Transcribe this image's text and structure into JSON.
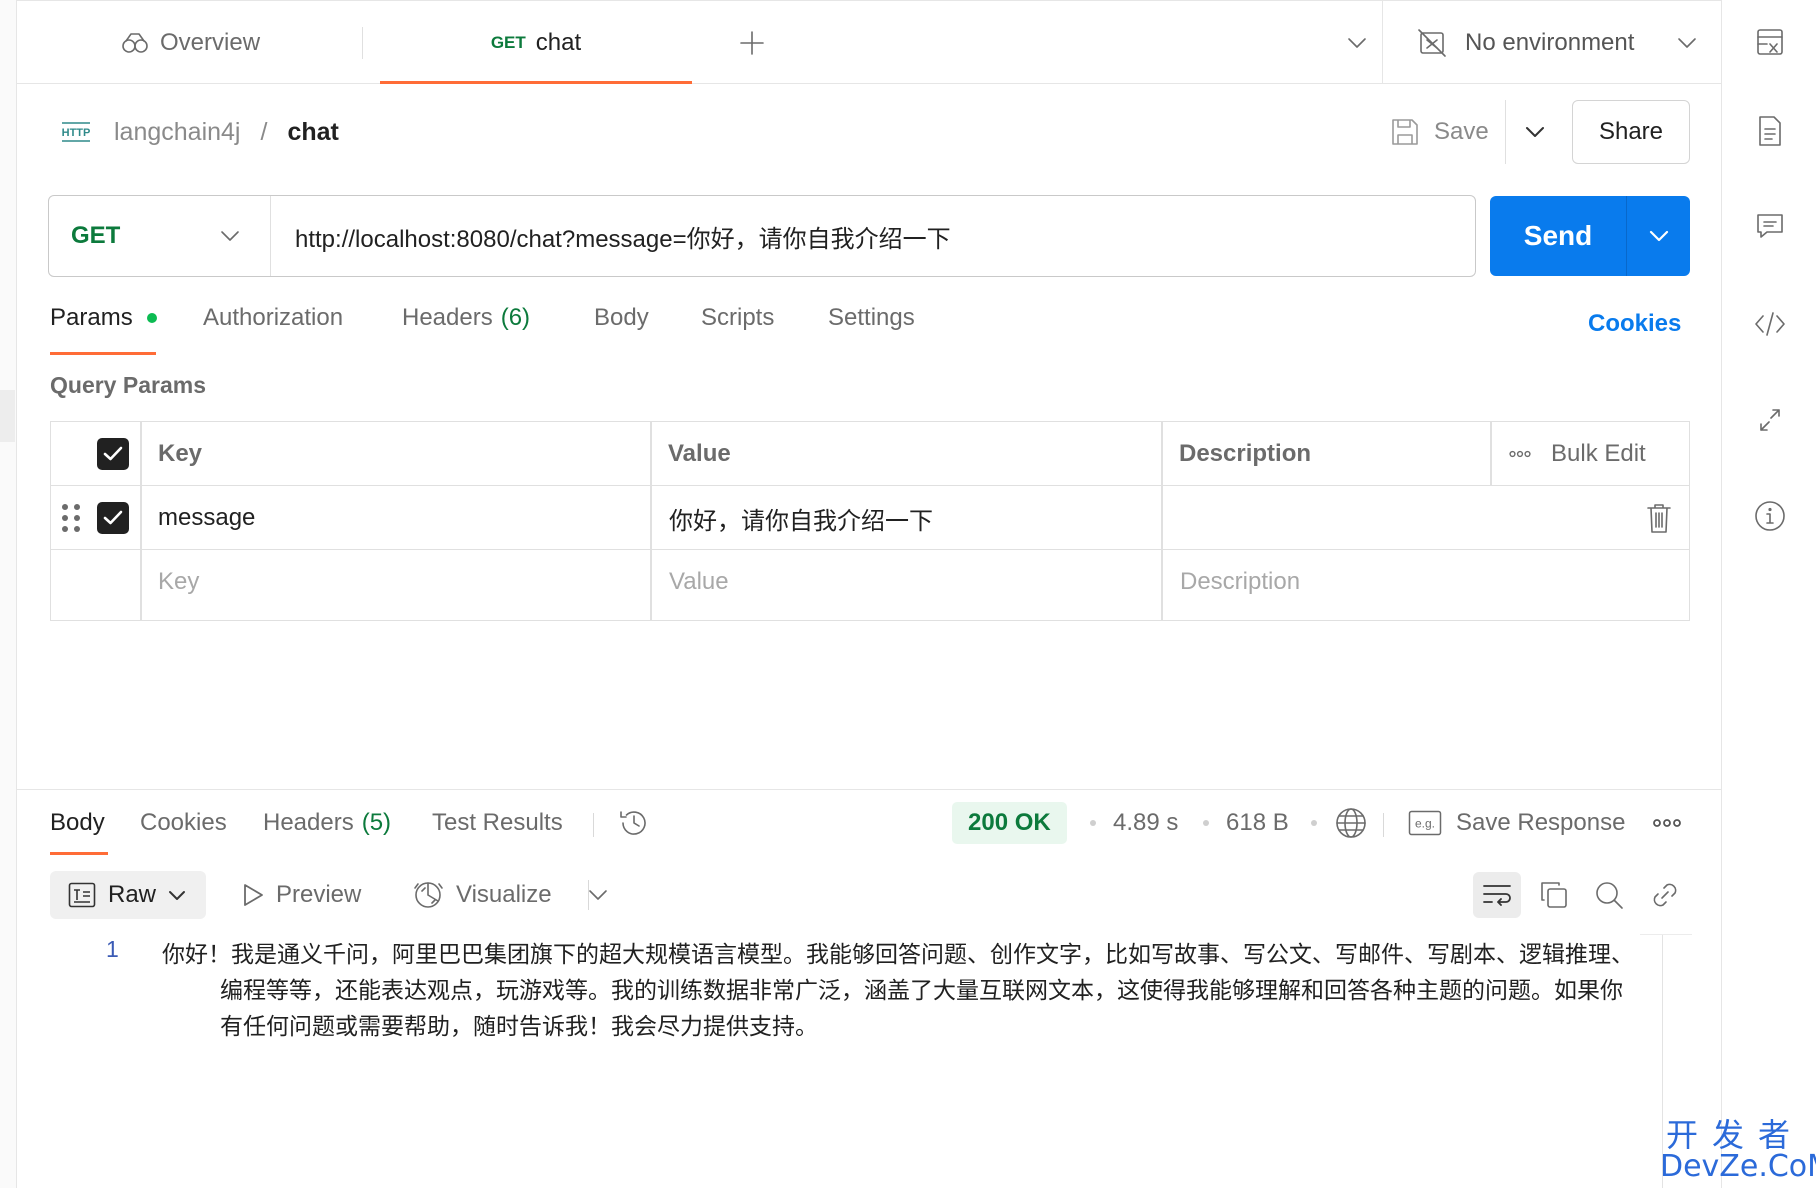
{
  "tabs": {
    "overview_label": "Overview",
    "active_method": "GET",
    "active_label": "chat"
  },
  "environment": {
    "label": "No environment"
  },
  "breadcrumb": {
    "collection": "langchain4j",
    "separator": "/",
    "request": "chat"
  },
  "header_actions": {
    "save_label": "Save",
    "share_label": "Share"
  },
  "request": {
    "method": "GET",
    "url": "http://localhost:8080/chat?message=你好，请你自我介绍一下",
    "send_label": "Send"
  },
  "request_tabs": {
    "params": "Params",
    "authorization": "Authorization",
    "headers": "Headers",
    "headers_count": "(6)",
    "body": "Body",
    "scripts": "Scripts",
    "settings": "Settings",
    "cookies": "Cookies"
  },
  "query_params": {
    "title": "Query Params",
    "columns": {
      "key": "Key",
      "value": "Value",
      "description": "Description",
      "bulk_edit": "Bulk Edit"
    },
    "rows": [
      {
        "key": "message",
        "value": "你好，请你自我介绍一下",
        "description": ""
      }
    ],
    "placeholders": {
      "key": "Key",
      "value": "Value",
      "description": "Description"
    }
  },
  "response_tabs": {
    "body": "Body",
    "cookies": "Cookies",
    "headers": "Headers",
    "headers_count": "(5)",
    "test_results": "Test Results"
  },
  "response_meta": {
    "status": "200 OK",
    "time": "4.89 s",
    "size": "618 B",
    "save_response": "Save Response"
  },
  "response_toolbar": {
    "format": "Raw",
    "preview": "Preview",
    "visualize": "Visualize"
  },
  "response_body": {
    "line_number": "1",
    "text": "你好！我是通义千问，阿里巴巴集团旗下的超大规模语言模型。我能够回答问题、创作文字，比如写故事、写公文、写邮件、写剧本、逻辑推理、编程等等，还能表达观点，玩游戏等。我的训练数据非常广泛，涵盖了大量互联网文本，这使得我能够理解和回答各种主题的问题。如果你有任何问题或需要帮助，随时告诉我！我会尽力提供支持。"
  },
  "watermark": {
    "line1": "开发者",
    "line2": "DevZe.CoM"
  },
  "colors": {
    "accent": "#ff6c37",
    "send": "#097bed",
    "method_get": "#0c7a3c",
    "status_ok_bg": "#e9f7ee"
  },
  "icons": [
    "overview-icon",
    "add-tab-icon",
    "chevron-down-icon",
    "no-environment-icon",
    "environment-variables-icon",
    "http-icon",
    "save-icon",
    "documentation-icon",
    "comments-icon",
    "code-icon",
    "related-icon",
    "info-icon",
    "trash-icon",
    "history-icon",
    "globe-icon",
    "example-icon",
    "more-icon",
    "raw-icon",
    "preview-icon",
    "visualize-icon",
    "wrap-icon",
    "copy-icon",
    "search-icon",
    "link-icon"
  ]
}
